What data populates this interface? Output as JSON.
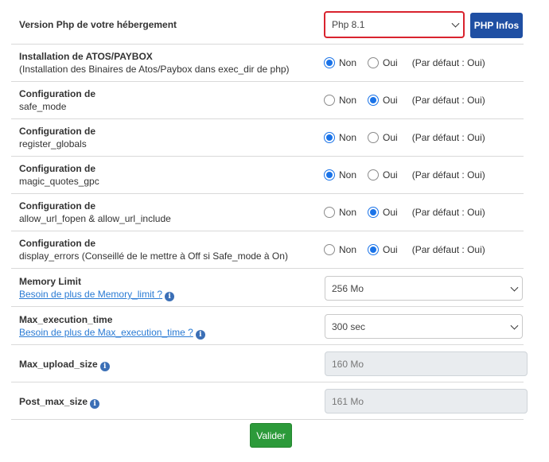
{
  "php_version": {
    "label": "Version Php de votre hébergement",
    "selected": "Php 8.1",
    "info_button": "PHP Infos"
  },
  "radio_labels": {
    "no": "Non",
    "yes": "Oui"
  },
  "options": [
    {
      "title": "Installation de ATOS/PAYBOX",
      "subtitle": "(Installation des Binaires de Atos/Paybox dans exec_dir de php)",
      "checked": "Non",
      "default": "(Par défaut : Oui)"
    },
    {
      "title": "Configuration de",
      "subtitle": "safe_mode",
      "checked": "Oui",
      "default": "(Par défaut : Oui)"
    },
    {
      "title": "Configuration de",
      "subtitle": "register_globals",
      "checked": "Non",
      "default": "(Par défaut : Oui)"
    },
    {
      "title": "Configuration de",
      "subtitle": "magic_quotes_gpc",
      "checked": "Non",
      "default": "(Par défaut : Oui)"
    },
    {
      "title": "Configuration de",
      "subtitle": "allow_url_fopen & allow_url_include",
      "checked": "Oui",
      "default": "(Par défaut : Oui)"
    },
    {
      "title": "Configuration de",
      "subtitle": "display_errors (Conseillé de le mettre à Off si Safe_mode à On)",
      "checked": "Oui",
      "default": "(Par défaut : Oui)"
    }
  ],
  "memory_limit": {
    "label": "Memory Limit",
    "help": "Besoin de plus de Memory_limit ?",
    "selected": "256 Mo"
  },
  "max_execution_time": {
    "label": "Max_execution_time",
    "help": "Besoin de plus de Max_execution_time ?",
    "selected": "300 sec"
  },
  "max_upload_size": {
    "label": "Max_upload_size",
    "value": "160 Mo"
  },
  "post_max_size": {
    "label": "Post_max_size",
    "value": "161 Mo"
  },
  "submit_label": "Valider",
  "icons": {
    "info": "info-icon",
    "dropdown": "chevron-down-icon"
  },
  "colors": {
    "primary": "#1f4fa3",
    "success": "#2c9a3a",
    "highlight": "#d9232e",
    "radio": "#1a73e8",
    "link": "#2a7bd4"
  }
}
